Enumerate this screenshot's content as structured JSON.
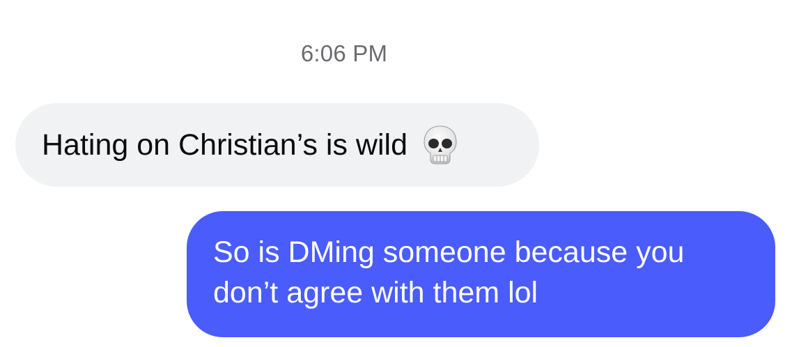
{
  "conversation": {
    "timestamp": "6:06 PM",
    "messages": [
      {
        "direction": "incoming",
        "text": "Hating on Christian’s is wild",
        "emoji": "skull-emoji"
      },
      {
        "direction": "outgoing",
        "text": "So is DMing someone because you don’t agree with them lol"
      }
    ]
  },
  "colors": {
    "incoming_bubble": "#f1f2f4",
    "outgoing_bubble": "#4a5cfb",
    "timestamp_text": "#6b6b70"
  }
}
